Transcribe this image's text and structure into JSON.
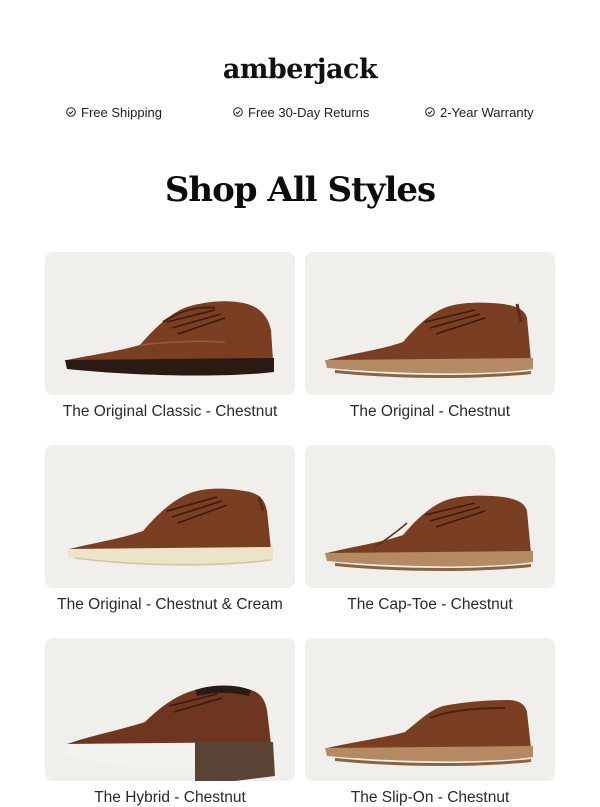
{
  "brand": {
    "logo": "amberjack"
  },
  "benefits": [
    {
      "label": "Free Shipping",
      "icon": "check-circle-icon"
    },
    {
      "label": "Free 30-Day Returns",
      "icon": "check-circle-icon"
    },
    {
      "label": "2-Year Warranty",
      "icon": "check-circle-icon"
    }
  ],
  "section": {
    "title": "Shop All Styles"
  },
  "products": [
    {
      "name": "The Original Classic - Chestnut"
    },
    {
      "name": "The Original - Chestnut"
    },
    {
      "name": "The Original - Chestnut & Cream"
    },
    {
      "name": "The Cap-Toe - Chestnut"
    },
    {
      "name": "The Hybrid - Chestnut"
    },
    {
      "name": "The Slip-On - Chestnut"
    }
  ],
  "colors": {
    "card_bg": "#f1efec",
    "leather": "#7a3e22",
    "sole_dark": "#2b1a14",
    "sole_tan": "#b58a62",
    "sole_cream": "#ece4c6",
    "sole_white": "#f4f2ee"
  }
}
